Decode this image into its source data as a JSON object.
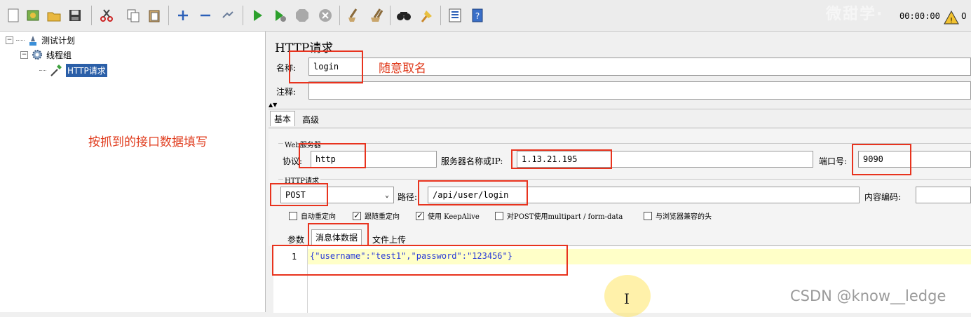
{
  "toolbar": {
    "icons": [
      "new-icon",
      "templates-icon",
      "open-icon",
      "save-icon",
      "cut-icon",
      "copy-icon",
      "paste-icon",
      "expand-icon",
      "collapse-icon",
      "toggle-icon",
      "start-icon",
      "start-no-pause-icon",
      "stop-icon",
      "shutdown-icon",
      "clear-icon",
      "clear-all-icon",
      "search-icon",
      "reset-search-icon",
      "function-helper-icon",
      "help-icon",
      "warning-icon"
    ],
    "timer": "00:00:00",
    "warning_count": "0",
    "watermark": "微甜学·"
  },
  "tree": {
    "root": "测试计划",
    "thread_group": "线程组",
    "sampler": "HTTP请求"
  },
  "annotations": {
    "name_hint": "随意取名",
    "fill_hint": "按抓到的接口数据填写"
  },
  "sampler": {
    "title": "HTTP请求",
    "name_label": "名称:",
    "name_value": "login",
    "comment_label": "注释:",
    "comment_value": "",
    "tabs": [
      "基本",
      "高级"
    ],
    "web_server_group": "Web服务器",
    "protocol_label": "协议:",
    "protocol_value": "http",
    "server_label": "服务器名称或IP:",
    "server_value": "1.13.21.195",
    "port_label": "端口号:",
    "port_value": "9090",
    "http_request_group": "HTTP请求",
    "method_value": "POST",
    "path_label": "路径:",
    "path_value": "/api/user/login",
    "encoding_label": "内容编码:",
    "encoding_value": "",
    "checkboxes": [
      {
        "label": "自动重定向",
        "checked": false
      },
      {
        "label": "跟随重定向",
        "checked": true
      },
      {
        "label": "使用 KeepAlive",
        "checked": true
      },
      {
        "label": "对POST使用multipart / form-data",
        "checked": false
      },
      {
        "label": "与浏览器兼容的头",
        "checked": false
      }
    ],
    "body_tabs": [
      "参数",
      "消息体数据",
      "文件上传"
    ],
    "line_number": "1",
    "body_value": "{\"username\":\"test1\",\"password\":\"123456\"}"
  },
  "watermark": "CSDN @know__ledge",
  "colors": {
    "annotation": "#e03c1e",
    "highlight_box": "#e8331e",
    "selection": "#2b5fa8",
    "editor_text": "#2a3bd8"
  }
}
